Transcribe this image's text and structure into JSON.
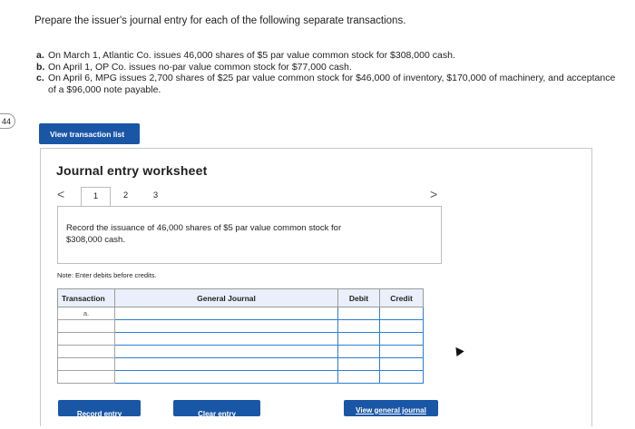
{
  "question": {
    "title": "Prepare the issuer's journal entry for each of the following separate transactions.",
    "items": [
      {
        "label": "a.",
        "text": "On March 1, Atlantic Co. issues 46,000 shares of $5 par value common stock for $308,000 cash."
      },
      {
        "label": "b.",
        "text": "On April 1, OP Co. issues no-par value common stock for $77,000 cash."
      },
      {
        "label": "c.",
        "text": "On April 6, MPG issues 2,700 shares of $25 par value common stock for $46,000 of inventory, $170,000 of machinery, and acceptance of a $96,000 note payable."
      }
    ]
  },
  "side_badge": "44",
  "view_transaction_button": "View transaction list",
  "worksheet": {
    "title": "Journal entry worksheet",
    "prev_symbol": "<",
    "next_symbol": ">",
    "tabs": [
      "1",
      "2",
      "3"
    ],
    "instruction": "Record the issuance of 46,000 shares of $5 par value common stock for $308,000 cash.",
    "note": "Note: Enter debits before credits."
  },
  "journal_table": {
    "headers": {
      "transaction": "Transaction",
      "account": "General Journal",
      "debit": "Debit",
      "credit": "Credit"
    },
    "first_transaction": "a."
  },
  "buttons": {
    "record": "Record entry",
    "clear": "Clear entry",
    "view_general": "View general journal"
  }
}
